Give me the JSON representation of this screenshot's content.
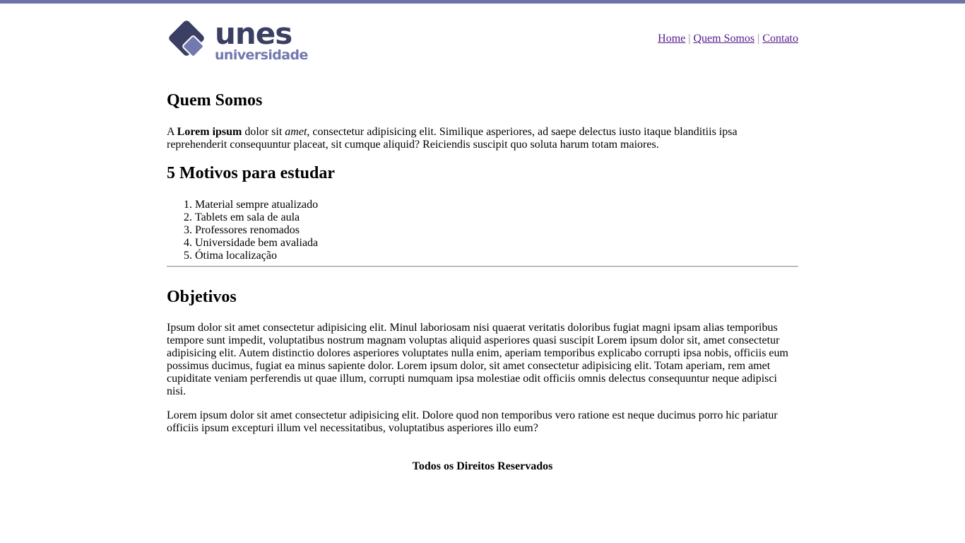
{
  "brand": {
    "logo_text_main": "unes",
    "logo_text_sub": "universidade",
    "colors": {
      "dark": "#3a3f63",
      "light": "#7279ae",
      "top_bar": "#6b73a8"
    }
  },
  "nav": {
    "items": [
      {
        "label": "Home"
      },
      {
        "label": "Quem Somos"
      },
      {
        "label": "Contato"
      }
    ],
    "separator": "|"
  },
  "about": {
    "title": "Quem Somos",
    "intro_prefix": "A ",
    "intro_bold": "Lorem ipsum",
    "intro_mid": " dolor sit ",
    "intro_italic": "amet",
    "intro_rest": ", consectetur adipisicing elit. Similique asperiores, ad saepe delectus iusto itaque blanditiis ipsa reprehenderit consequuntur placeat, sit cumque aliquid? Reiciendis suscipit quo soluta harum totam maiores."
  },
  "reasons": {
    "title": "5 Motivos para estudar",
    "items": [
      "Material sempre atualizado",
      "Tablets em sala de aula",
      "Professores renomados",
      "Universidade bem avaliada",
      "Ótima localização"
    ]
  },
  "objectives": {
    "title": "Objetivos",
    "paragraph1": "Ipsum dolor sit amet consectetur adipisicing elit. Minul laboriosam nisi quaerat veritatis doloribus fugiat magni ipsam alias temporibus tempore sunt impedit, voluptatibus nostrum magnam voluptas aliquid asperiores quasi suscipit Lorem ipsum dolor sit, amet consectetur adipisicing elit. Autem distinctio dolores asperiores voluptates nulla enim, aperiam temporibus explicabo corrupti ipsa nobis, officiis eum possimus ducimus, fugiat ea minus sapiente dolor. Lorem ipsum dolor, sit amet consectetur adipisicing elit. Totam aperiam, rem amet cupiditate veniam perferendis ut quae illum, corrupti numquam ipsa molestiae odit officiis omnis delectus consequuntur neque adipisci nisi.",
    "paragraph2": "Lorem ipsum dolor sit amet consectetur adipisicing elit. Dolore quod non temporibus vero ratione est neque ducimus porro hic pariatur officiis ipsum excepturi illum vel necessitatibus, voluptatibus asperiores illo eum?"
  },
  "footer": {
    "text": "Todos os Direitos Reservados"
  }
}
